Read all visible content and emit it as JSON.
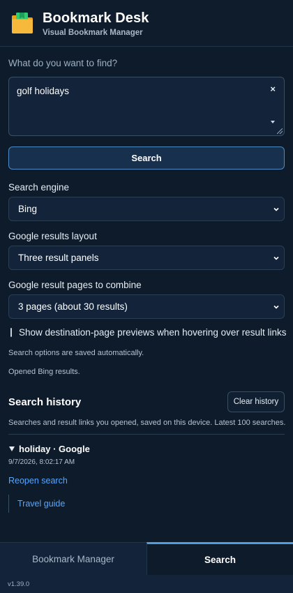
{
  "header": {
    "title": "Bookmark Desk",
    "subtitle": "Visual Bookmark Manager",
    "logo_icon": "folder-icon"
  },
  "search": {
    "prompt_label": "What do you want to find?",
    "query_value": "golf holidays",
    "clear_symbol": "×",
    "button_label": "Search"
  },
  "engine": {
    "label": "Search engine",
    "selected": "Bing"
  },
  "layout": {
    "label": "Google results layout",
    "selected": "Three result panels"
  },
  "pages": {
    "label": "Google result pages to combine",
    "selected": "3 pages (about 30 results)"
  },
  "preview": {
    "label": "Show destination-page previews when hovering over result links",
    "checked": false
  },
  "notes": {
    "saved": "Search options are saved automatically.",
    "status": "Opened Bing results."
  },
  "history": {
    "title": "Search history",
    "clear_label": "Clear history",
    "description": "Searches and result links you opened, saved on this device. Latest 100 searches.",
    "entries": [
      {
        "title": "holiday · Google",
        "time": "9/7/2026, 8:02:17 AM",
        "reopen_label": "Reopen search",
        "links": [
          "Travel guide"
        ]
      }
    ]
  },
  "tabs": [
    {
      "label": "Bookmark Manager",
      "active": false
    },
    {
      "label": "Search",
      "active": true
    }
  ],
  "footer": {
    "version": "v1.39.0"
  },
  "colors": {
    "background": "#0d1b2a",
    "panel": "#13233a",
    "accent": "#4f9fe0",
    "link": "#58a6ff",
    "logo_yellow": "#f6b93b",
    "logo_green": "#2ecc71"
  }
}
